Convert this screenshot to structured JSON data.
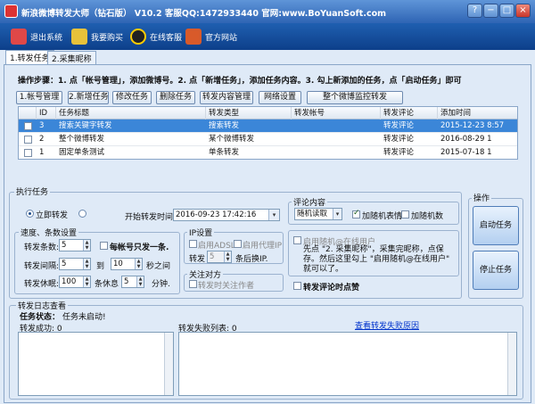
{
  "window": {
    "title": "新浪微博转发大师（钻石版） V10.2 客服QQ:1472933440 官网:www.BoYuanSoft.com",
    "controls": [
      "?",
      "−",
      "□",
      "×"
    ]
  },
  "toolbar": [
    {
      "label": "退出系统",
      "icon": "exit-icon",
      "color": "#e04848"
    },
    {
      "label": "我要购买",
      "icon": "cart-icon",
      "color": "#e8c23a"
    },
    {
      "label": "在线客服",
      "icon": "qq-penguin-icon",
      "color": "#222222"
    },
    {
      "label": "官方网站",
      "icon": "home-icon",
      "color": "#d85a2a"
    }
  ],
  "tabs": [
    {
      "label": "1.转发任务",
      "active": true
    },
    {
      "label": "2.采集昵称",
      "active": false
    }
  ],
  "steps_text": "操作步骤：1. 点「帐号管理」，添加微博号。2. 点「新增任务」，添加任务内容。3. 勾上新添加的任务，点「启动任务」即可",
  "action_buttons": [
    "1.帐号管理",
    "2.新增任务",
    "修改任务",
    "删除任务",
    "转发内容管理",
    "网络设置",
    "整个微博监控转发"
  ],
  "task_table": {
    "columns": [
      "",
      "ID",
      "任务标题",
      "转发类型",
      "转发帐号",
      "转发评论",
      "添加时间"
    ],
    "rows": [
      {
        "checked": false,
        "id": "3",
        "title": "搜索关键字转发",
        "type": "搜索转发",
        "account": "",
        "comment": "转发评论",
        "time": "2015-12-23 8:57",
        "selected": true
      },
      {
        "checked": false,
        "id": "2",
        "title": "整个微博转发",
        "type": "某个微博转发",
        "account": "",
        "comment": "转发评论",
        "time": "2016-08-29 1",
        "selected": false
      },
      {
        "checked": false,
        "id": "1",
        "title": "固定单条测试",
        "type": "单条转发",
        "account": "",
        "comment": "转发评论",
        "time": "2015-07-18 1",
        "selected": false
      }
    ]
  },
  "execute": {
    "legend": "执行任务",
    "immediate_label": "立即转发",
    "start_time_label": "开始转发时间:",
    "start_time_value": "2016-09-23 17:42:16",
    "comment_legend": "评论内容",
    "comment_source": "随机读取",
    "add_emoji_label": "加随机表情",
    "add_emoji_checked": true,
    "add_number_label": "加随机数",
    "add_number_checked": false,
    "speed_legend": "速度、条数设置",
    "forward_count_label": "转发条数:",
    "forward_count_value": "5",
    "one_per_account_label": "每帐号只发一条.",
    "one_per_account_checked": false,
    "interval_label": "转发间隔:",
    "interval_min": "5",
    "interval_to": "到",
    "interval_max": "10",
    "interval_unit": "秒之间",
    "rest_label": "转发休眠:",
    "rest_every": "100",
    "rest_mid": "条休息",
    "rest_minutes": "5",
    "rest_unit": "分钟.",
    "ip_legend": "IP设置",
    "ip_adsl_label": "启用ADSL",
    "ip_proxy_label": "启用代理IP",
    "ip_forward_label": "转发",
    "ip_forward_value": "5",
    "ip_switch_label": "条后换IP.",
    "follow_legend": "关注对方",
    "follow_label": "转发时关注作者",
    "random_user_label": "启用随机@在线用户",
    "random_user_note": "先点 \"2. 采集昵称\"，采集完昵称，点保存。然后这里勾上 \"启用随机@在线用户\" 就可以了。",
    "like_label": "转发评论时点赞",
    "like_checked": false
  },
  "operations": {
    "legend": "操作",
    "start_label": "启动任务",
    "stop_label": "停止任务"
  },
  "log": {
    "legend": "转发日志查看",
    "status_label": "任务状态：",
    "status_value": "任务未启动!",
    "success_label": "转发成功: 0",
    "failed_label": "转发失败列表: 0",
    "view_failed_link": "查看转发失败原因"
  }
}
